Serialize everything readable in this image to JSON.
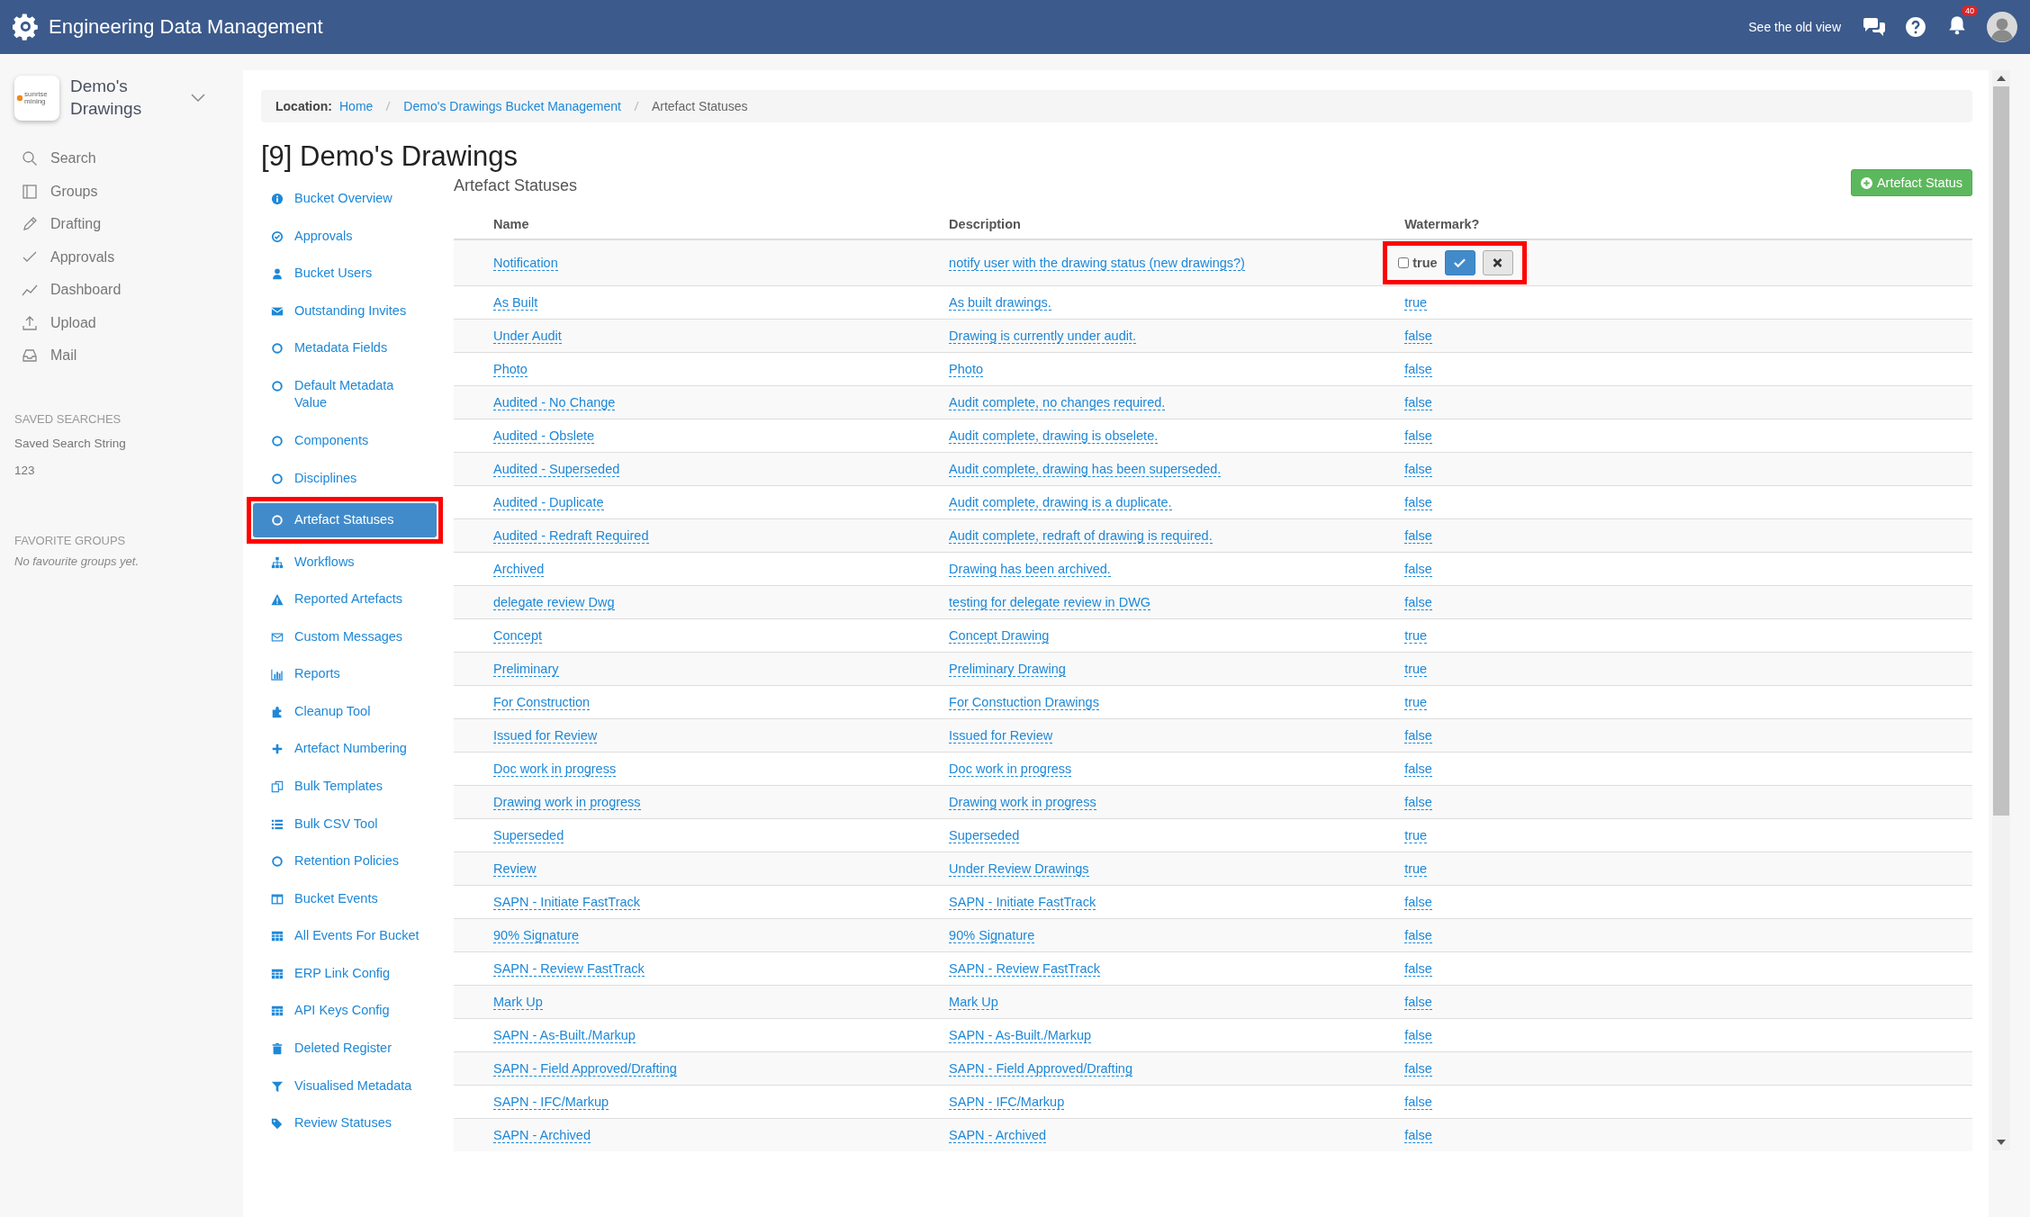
{
  "app_bar": {
    "title": "Engineering Data Management",
    "old_view_link": "See the old view",
    "notification_count": "40"
  },
  "sidebar": {
    "logo_text": "sunrise mining",
    "workspace": "Demo's Drawings",
    "menu": [
      {
        "label": "Search"
      },
      {
        "label": "Groups"
      },
      {
        "label": "Drafting"
      },
      {
        "label": "Approvals"
      },
      {
        "label": "Dashboard"
      },
      {
        "label": "Upload"
      },
      {
        "label": "Mail"
      }
    ],
    "saved_searches": {
      "heading": "SAVED SEARCHES",
      "items": [
        "Saved Search String",
        "123"
      ]
    },
    "favorite_groups": {
      "heading": "FAVORITE GROUPS",
      "empty_note": "No favourite groups yet."
    }
  },
  "breadcrumb": {
    "label": "Location:",
    "items": [
      {
        "text": "Home",
        "link": true
      },
      {
        "text": "Demo's Drawings Bucket Management",
        "link": true
      },
      {
        "text": "Artefact Statuses",
        "link": false
      }
    ]
  },
  "page_title": "[9] Demo's Drawings",
  "bucket_nav": [
    {
      "label": "Bucket Overview",
      "selected": false
    },
    {
      "label": "Approvals",
      "selected": false
    },
    {
      "label": "Bucket Users",
      "selected": false
    },
    {
      "label": "Outstanding Invites",
      "selected": false
    },
    {
      "label": "Metadata Fields",
      "selected": false
    },
    {
      "label": "Default Metadata Value",
      "selected": false
    },
    {
      "label": "Components",
      "selected": false
    },
    {
      "label": "Disciplines",
      "selected": false
    },
    {
      "label": "Artefact Statuses",
      "selected": true
    },
    {
      "label": "Workflows",
      "selected": false
    },
    {
      "label": "Reported Artefacts",
      "selected": false
    },
    {
      "label": "Custom Messages",
      "selected": false
    },
    {
      "label": "Reports",
      "selected": false
    },
    {
      "label": "Cleanup Tool",
      "selected": false
    },
    {
      "label": "Artefact Numbering",
      "selected": false
    },
    {
      "label": "Bulk Templates",
      "selected": false
    },
    {
      "label": "Bulk CSV Tool",
      "selected": false
    },
    {
      "label": "Retention Policies",
      "selected": false
    },
    {
      "label": "Bucket Events",
      "selected": false
    },
    {
      "label": "All Events For Bucket",
      "selected": false
    },
    {
      "label": "ERP Link Config",
      "selected": false
    },
    {
      "label": "API Keys Config",
      "selected": false
    },
    {
      "label": "Deleted Register",
      "selected": false
    },
    {
      "label": "Visualised Metadata",
      "selected": false
    },
    {
      "label": "Review Statuses",
      "selected": false
    }
  ],
  "section_title": "Artefact Statuses",
  "add_button": "Artefact Status",
  "table": {
    "columns": [
      "Name",
      "Description",
      "Watermark?"
    ],
    "rows": [
      {
        "name": "Notification",
        "description": "notify user with the drawing status (new drawings?)",
        "kind": "editing",
        "watermark": "true",
        "checked": false
      },
      {
        "name": "As Built",
        "description": "As built drawings.",
        "kind": "view",
        "watermark": "true"
      },
      {
        "name": "Under Audit",
        "description": "Drawing is currently under audit.",
        "kind": "view",
        "watermark": "false"
      },
      {
        "name": "Photo",
        "description": "Photo",
        "kind": "view",
        "watermark": "false"
      },
      {
        "name": "Audited - No Change",
        "description": "Audit complete, no changes required.",
        "kind": "view",
        "watermark": "false"
      },
      {
        "name": "Audited - Obslete",
        "description": "Audit complete, drawing is obselete.",
        "kind": "view",
        "watermark": "false"
      },
      {
        "name": "Audited - Superseded",
        "description": "Audit complete, drawing has been superseded.",
        "kind": "view",
        "watermark": "false"
      },
      {
        "name": "Audited - Duplicate",
        "description": "Audit complete, drawing is a duplicate.",
        "kind": "view",
        "watermark": "false"
      },
      {
        "name": "Audited - Redraft Required",
        "description": "Audit complete, redraft of drawing is required.",
        "kind": "view",
        "watermark": "false"
      },
      {
        "name": "Archived",
        "description": "Drawing has been archived.",
        "kind": "view",
        "watermark": "false"
      },
      {
        "name": "delegate review Dwg",
        "description": "testing for delegate review in DWG",
        "kind": "view",
        "watermark": "false"
      },
      {
        "name": "Concept",
        "description": "Concept Drawing",
        "kind": "view",
        "watermark": "true"
      },
      {
        "name": "Preliminary",
        "description": "Preliminary Drawing",
        "kind": "view",
        "watermark": "true"
      },
      {
        "name": "For Construction",
        "description": "For Constuction Drawings",
        "kind": "view",
        "watermark": "true"
      },
      {
        "name": "Issued for Review",
        "description": "Issued for Review",
        "kind": "view",
        "watermark": "false"
      },
      {
        "name": "Doc work in progress",
        "description": "Doc work in progress",
        "kind": "view",
        "watermark": "false"
      },
      {
        "name": "Drawing work in progress",
        "description": "Drawing work in progress",
        "kind": "view",
        "watermark": "false"
      },
      {
        "name": "Superseded",
        "description": "Superseded",
        "kind": "view",
        "watermark": "true"
      },
      {
        "name": "Review",
        "description": "Under Review Drawings",
        "kind": "view",
        "watermark": "true"
      },
      {
        "name": "SAPN - Initiate FastTrack",
        "description": "SAPN - Initiate FastTrack",
        "kind": "view",
        "watermark": "false"
      },
      {
        "name": "90% Signature",
        "description": "90% Signature",
        "kind": "view",
        "watermark": "false"
      },
      {
        "name": "SAPN - Review FastTrack",
        "description": "SAPN - Review FastTrack",
        "kind": "view",
        "watermark": "false"
      },
      {
        "name": "Mark Up",
        "description": "Mark Up",
        "kind": "view",
        "watermark": "false"
      },
      {
        "name": "SAPN - As-Built./Markup",
        "description": "SAPN - As-Built./Markup",
        "kind": "view",
        "watermark": "false"
      },
      {
        "name": "SAPN - Field Approved/Drafting",
        "description": "SAPN - Field Approved/Drafting",
        "kind": "view",
        "watermark": "false"
      },
      {
        "name": "SAPN - IFC/Markup",
        "description": "SAPN - IFC/Markup",
        "kind": "view",
        "watermark": "false"
      },
      {
        "name": "SAPN - Archived",
        "description": "SAPN - Archived",
        "kind": "view",
        "watermark": "false"
      }
    ]
  }
}
